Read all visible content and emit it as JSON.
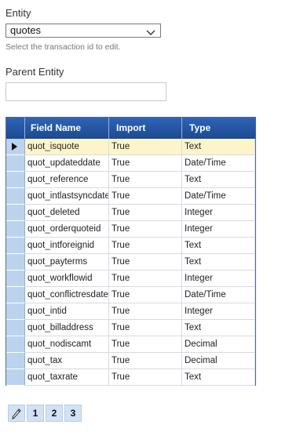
{
  "entity_label": "Entity",
  "entity_value": "quotes",
  "entity_hint": "Select the transaction id to edit.",
  "parent_label": "Parent Entity",
  "parent_value": "",
  "grid": {
    "columns": [
      "Field Name",
      "Import",
      "Type"
    ],
    "rows": [
      {
        "field": "quot_isquote",
        "import": "True",
        "type": "Text"
      },
      {
        "field": "quot_updateddate",
        "import": "True",
        "type": "Date/Time"
      },
      {
        "field": "quot_reference",
        "import": "True",
        "type": "Text"
      },
      {
        "field": "quot_intlastsyncdate",
        "import": "True",
        "type": "Date/Time"
      },
      {
        "field": "quot_deleted",
        "import": "True",
        "type": "Integer"
      },
      {
        "field": "quot_orderquoteid",
        "import": "True",
        "type": "Integer"
      },
      {
        "field": "quot_intforeignid",
        "import": "True",
        "type": "Text"
      },
      {
        "field": "quot_payterms",
        "import": "True",
        "type": "Text"
      },
      {
        "field": "quot_workflowid",
        "import": "True",
        "type": "Integer"
      },
      {
        "field": "quot_conflictresdate",
        "import": "True",
        "type": "Date/Time"
      },
      {
        "field": "quot_intid",
        "import": "True",
        "type": "Integer"
      },
      {
        "field": "quot_billaddress",
        "import": "True",
        "type": "Text"
      },
      {
        "field": "quot_nodiscamt",
        "import": "True",
        "type": "Decimal"
      },
      {
        "field": "quot_tax",
        "import": "True",
        "type": "Decimal"
      },
      {
        "field": "quot_taxrate",
        "import": "True",
        "type": "Text"
      }
    ],
    "selected_index": 0
  },
  "pager": {
    "edit_icon": "pencil-icon",
    "pages": [
      "1",
      "2",
      "3"
    ]
  },
  "colors": {
    "header": "#2e63b6",
    "selected_row": "#fdf5c9",
    "selector": "#bcd3ee"
  }
}
